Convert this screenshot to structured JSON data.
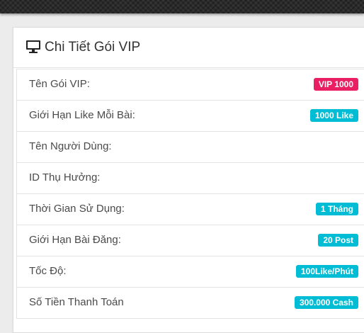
{
  "panel": {
    "title": "Chi Tiết Gói VIP",
    "icon": "monitor-icon"
  },
  "colors": {
    "badge_pink": "#e91e63",
    "badge_cyan": "#00bcd4"
  },
  "rows": [
    {
      "label": "Tên Gói VIP:",
      "value": "VIP 1000",
      "badge_color": "#e91e63"
    },
    {
      "label": "Giới Hạn Like Mỗi Bài:",
      "value": "1000 Like",
      "badge_color": "#00bcd4"
    },
    {
      "label": "Tên Người Dùng:",
      "value": "",
      "badge_color": ""
    },
    {
      "label": "ID Thụ Hưởng:",
      "value": "",
      "badge_color": ""
    },
    {
      "label": "Thời Gian Sử Dụng:",
      "value": "1 Tháng",
      "badge_color": "#00bcd4"
    },
    {
      "label": "Giới Hạn Bài Đăng:",
      "value": "20 Post",
      "badge_color": "#00bcd4"
    },
    {
      "label": "Tốc Độ:",
      "value": "100Like/Phút",
      "badge_color": "#00bcd4"
    },
    {
      "label": "Số Tiền Thanh Toán",
      "value": "300.000 Cash",
      "badge_color": "#00bcd4"
    }
  ]
}
